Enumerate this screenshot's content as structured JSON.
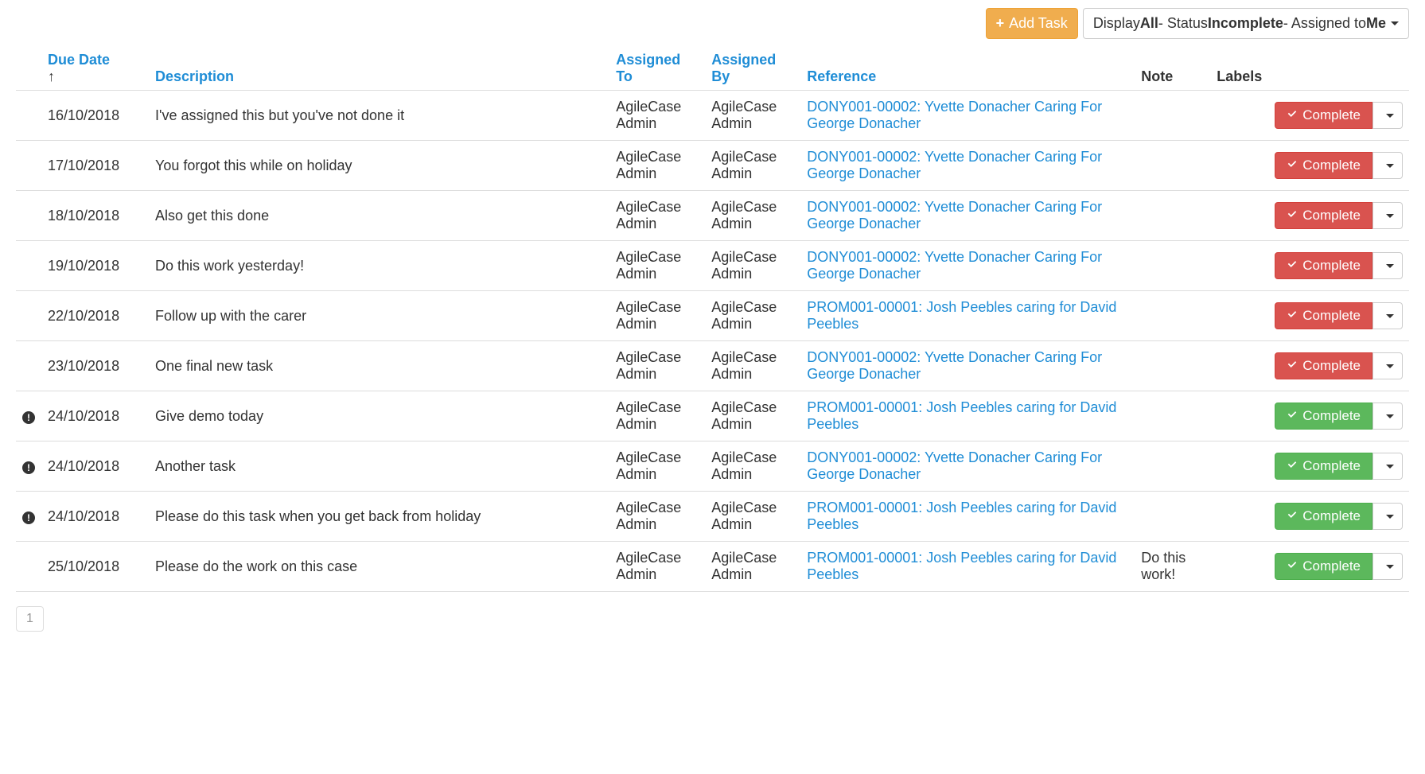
{
  "toolbar": {
    "add_label": "Add Task",
    "filter_prefix": "Display ",
    "filter_all": "All",
    "filter_mid1": " - Status ",
    "filter_status": "Incomplete",
    "filter_mid2": " - Assigned to ",
    "filter_assigned": "Me"
  },
  "headers": {
    "due": "Due Date",
    "description": "Description",
    "assigned_to": "Assigned To",
    "assigned_by": "Assigned By",
    "reference": "Reference",
    "note": "Note",
    "labels": "Labels"
  },
  "complete_label": "Complete",
  "rows": [
    {
      "alert": false,
      "due": "16/10/2018",
      "desc": "I've assigned this but you've not done it",
      "to": "AgileCase Admin",
      "by": "AgileCase Admin",
      "ref": "DONY001-00002: Yvette Donacher Caring For George Donacher",
      "note": "",
      "color": "red"
    },
    {
      "alert": false,
      "due": "17/10/2018",
      "desc": "You forgot this while on holiday",
      "to": "AgileCase Admin",
      "by": "AgileCase Admin",
      "ref": "DONY001-00002: Yvette Donacher Caring For George Donacher",
      "note": "",
      "color": "red"
    },
    {
      "alert": false,
      "due": "18/10/2018",
      "desc": "Also get this done",
      "to": "AgileCase Admin",
      "by": "AgileCase Admin",
      "ref": "DONY001-00002: Yvette Donacher Caring For George Donacher",
      "note": "",
      "color": "red"
    },
    {
      "alert": false,
      "due": "19/10/2018",
      "desc": "Do this work yesterday!",
      "to": "AgileCase Admin",
      "by": "AgileCase Admin",
      "ref": "DONY001-00002: Yvette Donacher Caring For George Donacher",
      "note": "",
      "color": "red"
    },
    {
      "alert": false,
      "due": "22/10/2018",
      "desc": "Follow up with the carer",
      "to": "AgileCase Admin",
      "by": "AgileCase Admin",
      "ref": "PROM001-00001: Josh Peebles caring for David Peebles",
      "note": "",
      "color": "red"
    },
    {
      "alert": false,
      "due": "23/10/2018",
      "desc": "One final new task",
      "to": "AgileCase Admin",
      "by": "AgileCase Admin",
      "ref": "DONY001-00002: Yvette Donacher Caring For George Donacher",
      "note": "",
      "color": "red"
    },
    {
      "alert": true,
      "due": "24/10/2018",
      "desc": "Give demo today",
      "to": "AgileCase Admin",
      "by": "AgileCase Admin",
      "ref": "PROM001-00001: Josh Peebles caring for David Peebles",
      "note": "",
      "color": "green"
    },
    {
      "alert": true,
      "due": "24/10/2018",
      "desc": "Another task",
      "to": "AgileCase Admin",
      "by": "AgileCase Admin",
      "ref": "DONY001-00002: Yvette Donacher Caring For George Donacher",
      "note": "",
      "color": "green"
    },
    {
      "alert": true,
      "due": "24/10/2018",
      "desc": "Please do this task when you get back from holiday",
      "to": "AgileCase Admin",
      "by": "AgileCase Admin",
      "ref": "PROM001-00001: Josh Peebles caring for David Peebles",
      "note": "",
      "color": "green"
    },
    {
      "alert": false,
      "due": "25/10/2018",
      "desc": "Please do the work on this case",
      "to": "AgileCase Admin",
      "by": "AgileCase Admin",
      "ref": "PROM001-00001: Josh Peebles caring for David Peebles",
      "note": "Do this work!",
      "color": "green"
    }
  ],
  "pager": {
    "page": "1"
  }
}
